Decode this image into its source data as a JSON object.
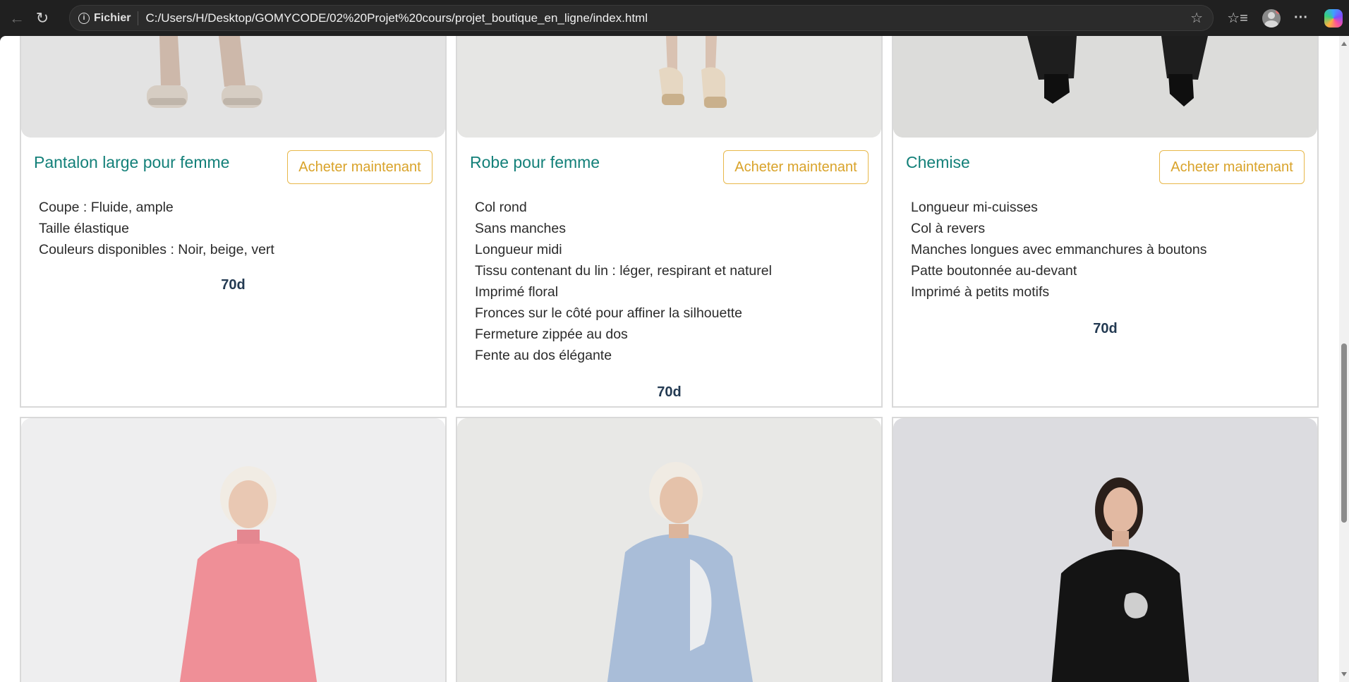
{
  "browser": {
    "info_label": "Fichier",
    "url": "C:/Users/H/Desktop/GOMYCODE/02%20Projet%20cours/projet_boutique_en_ligne/index.html"
  },
  "products": [
    {
      "title": "Pantalon large pour femme",
      "button": "Acheter maintenant",
      "features": [
        "Coupe : Fluide, ample",
        "Taille élastique",
        "Couleurs disponibles : Noir, beige, vert"
      ],
      "price": "70d"
    },
    {
      "title": "Robe pour femme",
      "button": "Acheter maintenant",
      "features": [
        "Col rond",
        "Sans manches",
        "Longueur midi",
        "Tissu contenant du lin : léger, respirant et naturel",
        "Imprimé floral",
        "Fronces sur le côté pour affiner la silhouette",
        "Fermeture zippée au dos",
        "Fente au dos élégante"
      ],
      "price": "70d"
    },
    {
      "title": "Chemise",
      "button": "Acheter maintenant",
      "features": [
        "Longueur mi-cuisses",
        "Col à revers",
        "Manches longues avec emmanchures à boutons",
        "Patte boutonnée au-devant",
        "Imprimé à petits motifs"
      ],
      "price": "70d"
    }
  ],
  "icons": [
    "back-arrow-icon",
    "reload-icon",
    "info-icon",
    "star-icon",
    "favorites-icon",
    "profile-icon",
    "more-icon",
    "copilot-icon"
  ]
}
